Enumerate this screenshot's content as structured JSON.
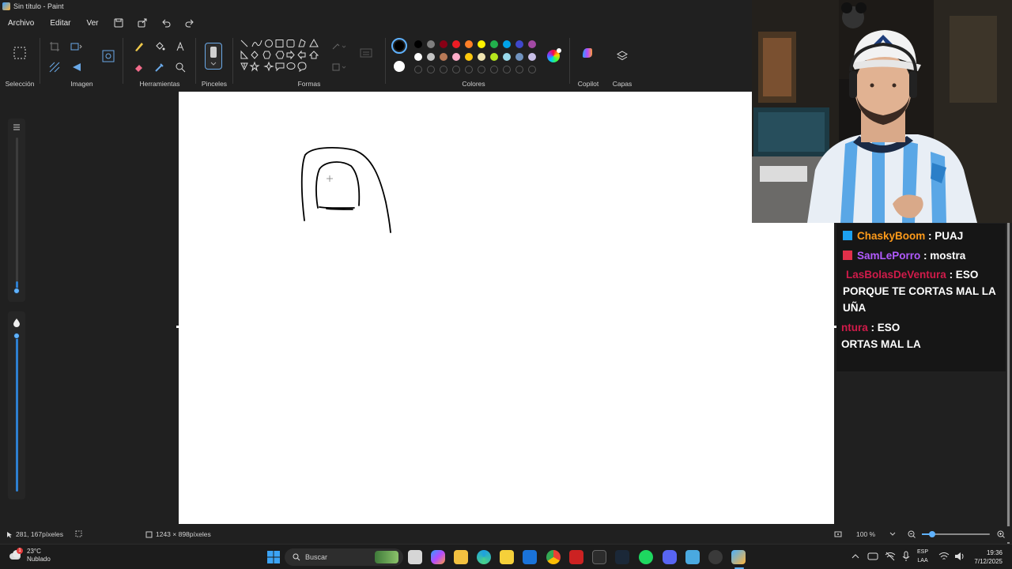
{
  "window": {
    "title": "Sin título - Paint"
  },
  "menu": {
    "items": [
      "Archivo",
      "Editar",
      "Ver"
    ]
  },
  "ribbon": {
    "groups": {
      "seleccion": "Selección",
      "imagen": "Imagen",
      "herramientas": "Herramientas",
      "pinceles": "Pinceles",
      "formas": "Formas",
      "colores": "Colores",
      "copilot": "Copilot",
      "capas": "Capas"
    },
    "colors": {
      "primary": "#000000",
      "secondary": "#ffffff",
      "row1": [
        "#000000",
        "#7f7f7f",
        "#880015",
        "#ed1c24",
        "#ff7f27",
        "#fff200",
        "#22b14c",
        "#00a2e8",
        "#3f48cc",
        "#a349a4"
      ],
      "row2": [
        "#ffffff",
        "#c3c3c3",
        "#b97a57",
        "#ffaec9",
        "#ffc90e",
        "#efe4b0",
        "#b5e61d",
        "#99d9ea",
        "#7092be",
        "#c8bfe7"
      ]
    }
  },
  "chat": {
    "messages": [
      {
        "user": "ChaskyBoom",
        "text": " : PUAJ"
      },
      {
        "user": "SamLePorro",
        "text": " : mostra"
      },
      {
        "user": "LasBolasDeVentura",
        "text": " : ESO"
      },
      {
        "user": "",
        "text": "PORQUE TE CORTAS MAL LA"
      },
      {
        "user": "",
        "text": "UÑA"
      },
      {
        "user": "ntura",
        "text": " : ESO"
      },
      {
        "user": "",
        "text": "ORTAS MAL LA"
      }
    ]
  },
  "status": {
    "cursor_position": "281, 167píxeles",
    "canvas_size": "1243 × 898píxeles",
    "zoom": "100 %",
    "zoom_slider_fraction": 0.15
  },
  "taskbar": {
    "weather_temp": "23°C",
    "weather_desc": "Nublado",
    "search_placeholder": "Buscar",
    "lang_line1": "ESP",
    "lang_line2": "LAA",
    "time": "19:36",
    "date": "7/12/2025",
    "weather_badge": "1"
  }
}
